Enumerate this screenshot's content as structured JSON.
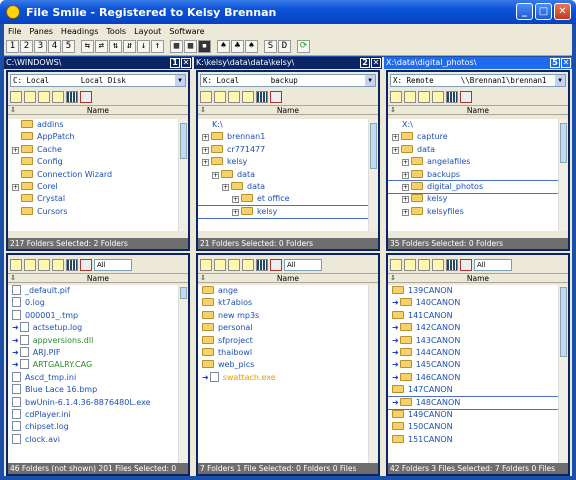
{
  "title": "File Smile - Registered to Kelsy Brennan",
  "menu": [
    "File",
    "Panes",
    "Headings",
    "Tools",
    "Layout",
    "Software"
  ],
  "toolbar": [
    "1",
    "2",
    "3",
    "4",
    "5",
    "D",
    "S"
  ],
  "columns": [
    {
      "path": "C:\\WINDOWS\\",
      "pane_number": "1",
      "active": false,
      "top": {
        "drive": "C: Local       Local Disk",
        "header": "Name",
        "items": [
          {
            "name": "addins",
            "type": "folder"
          },
          {
            "name": "AppPatch",
            "type": "folder"
          },
          {
            "name": "Cache",
            "type": "folder",
            "expand": true
          },
          {
            "name": "Config",
            "type": "folder"
          },
          {
            "name": "Connection Wizard",
            "type": "folder"
          },
          {
            "name": "Corel",
            "type": "folder",
            "expand": true
          },
          {
            "name": "Crystal",
            "type": "folder"
          },
          {
            "name": "Cursors",
            "type": "folder"
          }
        ],
        "status": "217 Folders   Selected: 2 Folders"
      },
      "bottom": {
        "filter": "All",
        "header": "Name",
        "items": [
          {
            "name": "_default.pif",
            "type": "file",
            "color": "blue"
          },
          {
            "name": "0.log",
            "type": "file",
            "color": "blue"
          },
          {
            "name": "000001_.tmp",
            "type": "file",
            "color": "blue"
          },
          {
            "name": "actsetup.log",
            "type": "file",
            "color": "blue",
            "arrow": true
          },
          {
            "name": "appversions.dll",
            "type": "file",
            "color": "green",
            "arrow": true
          },
          {
            "name": "ARJ.PIF",
            "type": "file",
            "color": "blue",
            "arrow": true
          },
          {
            "name": "ARTGALRY.CAG",
            "type": "file",
            "color": "green",
            "arrow": true
          },
          {
            "name": "Ascd_tmp.ini",
            "type": "file",
            "color": "blue"
          },
          {
            "name": "Blue Lace 16.bmp",
            "type": "file",
            "color": "blue"
          },
          {
            "name": "bwUnin-6.1.4.36-8876480L.exe",
            "type": "file",
            "color": "blue"
          },
          {
            "name": "cdPlayer.ini",
            "type": "file",
            "color": "blue"
          },
          {
            "name": "chipset.log",
            "type": "file",
            "color": "blue"
          },
          {
            "name": "clock.avi",
            "type": "file",
            "color": "blue"
          }
        ],
        "status": "46 Folders (not shown)  201 Files   Selected: 0"
      }
    },
    {
      "path": "K:\\kelsy\\data\\data\\kelsy\\",
      "pane_number": "2",
      "active": false,
      "top": {
        "drive": "K: Local       backup",
        "header": "Name",
        "items": [
          {
            "name": "K:\\",
            "type": "root",
            "indent": 1
          },
          {
            "name": "brennan1",
            "type": "folder",
            "indent": 0,
            "expand": true
          },
          {
            "name": "cr771477",
            "type": "folder",
            "indent": 0,
            "expand": true
          },
          {
            "name": "kelsy",
            "type": "folder",
            "indent": 0,
            "expand": true
          },
          {
            "name": "data",
            "type": "folder",
            "indent": 1,
            "expand": true
          },
          {
            "name": "data",
            "type": "folder",
            "indent": 2,
            "expand": true
          },
          {
            "name": "et office",
            "type": "folder",
            "indent": 3,
            "expand": true
          },
          {
            "name": "kelsy",
            "type": "folder",
            "indent": 3,
            "expand": true,
            "selected": true
          }
        ],
        "status": "21 Folders   Selected: 0 Folders"
      },
      "bottom": {
        "filter": "All",
        "header": "Name",
        "items": [
          {
            "name": "ange",
            "type": "folder",
            "color": "blue"
          },
          {
            "name": "kt7abios",
            "type": "folder",
            "color": "blue"
          },
          {
            "name": "new mp3s",
            "type": "folder",
            "color": "blue"
          },
          {
            "name": "personal",
            "type": "folder",
            "color": "blue"
          },
          {
            "name": "sfproject",
            "type": "folder",
            "color": "blue"
          },
          {
            "name": "thaibowl",
            "type": "folder",
            "color": "blue"
          },
          {
            "name": "web_pics",
            "type": "folder",
            "color": "blue"
          },
          {
            "name": "swattach.exe",
            "type": "file",
            "color": "orange",
            "arrow": true
          }
        ],
        "status": "7 Folders 1 File   Selected: 0 Folders 0 Files"
      }
    },
    {
      "path": "X:\\data\\digital_photos\\",
      "pane_number": "5",
      "active": true,
      "top": {
        "drive": "X: Remote      \\\\Brennan1\\brennan1",
        "header": "Name",
        "items": [
          {
            "name": "X:\\",
            "type": "root",
            "indent": 1
          },
          {
            "name": "capture",
            "type": "folder",
            "indent": 0,
            "expand": true
          },
          {
            "name": "data",
            "type": "folder",
            "indent": 0,
            "expand": true
          },
          {
            "name": "angelafiles",
            "type": "folder",
            "indent": 1,
            "expand": true
          },
          {
            "name": "backups",
            "type": "folder",
            "indent": 1,
            "expand": true
          },
          {
            "name": "digital_photos",
            "type": "folder",
            "indent": 1,
            "expand": true,
            "selected": true
          },
          {
            "name": "kelsy",
            "type": "folder",
            "indent": 1,
            "expand": true
          },
          {
            "name": "kelsyfiles",
            "type": "folder",
            "indent": 1,
            "expand": true
          }
        ],
        "status": "35 Folders   Selected: 0 Folders"
      },
      "bottom": {
        "filter": "All",
        "header": "Name",
        "items": [
          {
            "name": "139CANON",
            "type": "folder",
            "color": "blue"
          },
          {
            "name": "140CANON",
            "type": "folder",
            "color": "blue",
            "arrow": true
          },
          {
            "name": "141CANON",
            "type": "folder",
            "color": "blue"
          },
          {
            "name": "142CANON",
            "type": "folder",
            "color": "blue",
            "arrow": true
          },
          {
            "name": "143CANON",
            "type": "folder",
            "color": "blue",
            "arrow": true
          },
          {
            "name": "144CANON",
            "type": "folder",
            "color": "blue",
            "arrow": true
          },
          {
            "name": "145CANON",
            "type": "folder",
            "color": "blue",
            "arrow": true
          },
          {
            "name": "146CANON",
            "type": "folder",
            "color": "blue",
            "arrow": true
          },
          {
            "name": "147CANON",
            "type": "folder",
            "color": "blue"
          },
          {
            "name": "148CANON",
            "type": "folder",
            "color": "blue",
            "arrow": true,
            "selected": true
          },
          {
            "name": "149CANON",
            "type": "folder",
            "color": "blue"
          },
          {
            "name": "150CANON",
            "type": "folder",
            "color": "blue"
          },
          {
            "name": "151CANON",
            "type": "folder",
            "color": "blue"
          }
        ],
        "status": "42 Folders 3 Files   Selected: 7 Folders 0 Files"
      }
    }
  ]
}
